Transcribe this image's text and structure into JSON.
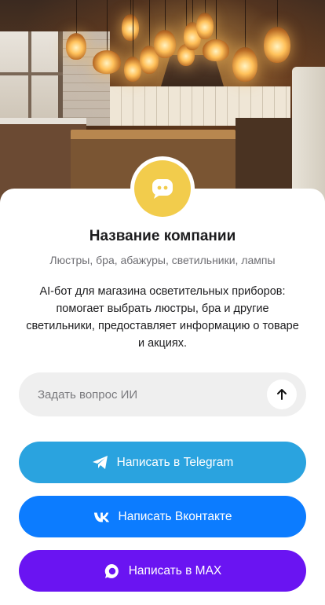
{
  "profile": {
    "company_name": "Название компании",
    "tagline": "Люстры, бра, абажуры, светильники, лампы",
    "description": "AI-бот для магазина осветительных приборов: помогает выбрать люстры, бра и другие светильники, предоставляет информацию о товаре и акциях.",
    "avatar_icon": "chat-bubble-icon",
    "avatar_color": "#F2CC4C"
  },
  "ask": {
    "placeholder": "Задать вопрос ИИ",
    "value": "",
    "send_icon": "arrow-up-icon"
  },
  "buttons": {
    "telegram": {
      "label": "Написать в Telegram",
      "icon": "telegram-icon",
      "color": "#2AA3DF"
    },
    "vk": {
      "label": "Написать Вконтакте",
      "icon": "vk-icon",
      "color": "#0C7CFF"
    },
    "max": {
      "label": "Написать в MAX",
      "icon": "max-icon",
      "color": "#6A14F2"
    }
  }
}
